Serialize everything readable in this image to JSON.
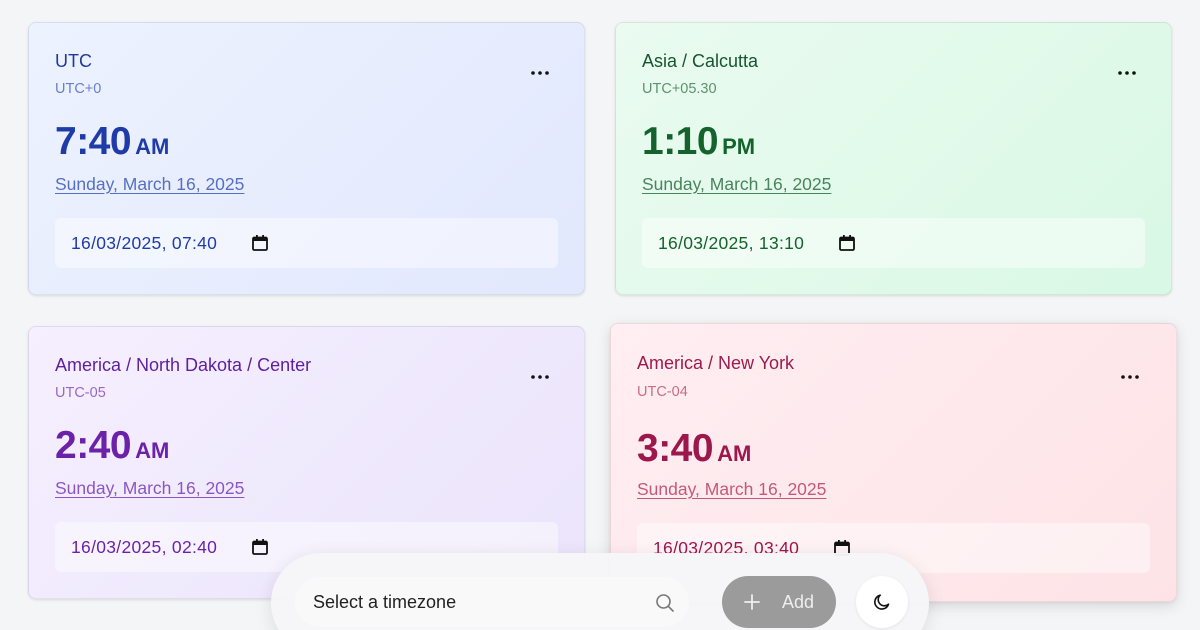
{
  "cards": [
    {
      "theme": "blue",
      "timezone": "UTC",
      "offset": "UTC+0",
      "time": "7:40",
      "ampm": "AM",
      "date": "Sunday, March 16, 2025",
      "datetime_value": "16/03/2025, 07:40",
      "menu_icon": "more-horizontal-icon",
      "calendar_icon": "calendar-icon"
    },
    {
      "theme": "green",
      "timezone": "Asia / Calcutta",
      "offset": "UTC+05.30",
      "time": "1:10",
      "ampm": "PM",
      "date": "Sunday, March 16, 2025",
      "datetime_value": "16/03/2025, 13:10",
      "menu_icon": "more-horizontal-icon",
      "calendar_icon": "calendar-icon"
    },
    {
      "theme": "purple",
      "timezone": "America / North Dakota / Center",
      "offset": "UTC-05",
      "time": "2:40",
      "ampm": "AM",
      "date": "Sunday, March 16, 2025",
      "datetime_value": "16/03/2025, 02:40",
      "menu_icon": "more-horizontal-icon",
      "calendar_icon": "calendar-icon"
    },
    {
      "theme": "red",
      "timezone": "America / New York",
      "offset": "UTC-04",
      "time": "3:40",
      "ampm": "AM",
      "date": "Sunday, March 16, 2025",
      "datetime_value": "16/03/2025, 03:40",
      "menu_icon": "more-horizontal-icon",
      "calendar_icon": "calendar-icon"
    }
  ],
  "toolbar": {
    "select_placeholder": "Select a timezone",
    "search_icon": "search-icon",
    "add_label": "Add",
    "add_icon": "plus-icon",
    "theme_toggle_icon": "moon-icon"
  },
  "colors": {
    "blue_accent": "#1e3ba8",
    "green_accent": "#14632d",
    "purple_accent": "#6b21a8",
    "red_accent": "#9d174d",
    "add_button_bg": "#9b9b9b"
  }
}
